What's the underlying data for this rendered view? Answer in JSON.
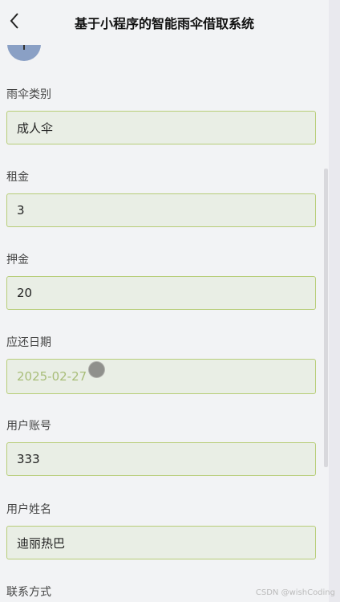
{
  "header": {
    "title": "基于小程序的智能雨伞借取系统",
    "back_icon": "chevron-left-icon"
  },
  "form": {
    "category": {
      "label": "雨伞类别",
      "value": "成人伞"
    },
    "rent": {
      "label": "租金",
      "value": "3"
    },
    "deposit": {
      "label": "押金",
      "value": "20"
    },
    "due_date": {
      "label": "应还日期",
      "value": "2025-02-27"
    },
    "account": {
      "label": "用户账号",
      "value": "333"
    },
    "username": {
      "label": "用户姓名",
      "value": "迪丽热巴"
    },
    "contact": {
      "label": "联系方式"
    }
  },
  "watermark": "CSDN @wishCoding",
  "colors": {
    "input_border": "#b7cd78",
    "input_bg": "#e9eee5",
    "date_text": "#a8bd78"
  }
}
